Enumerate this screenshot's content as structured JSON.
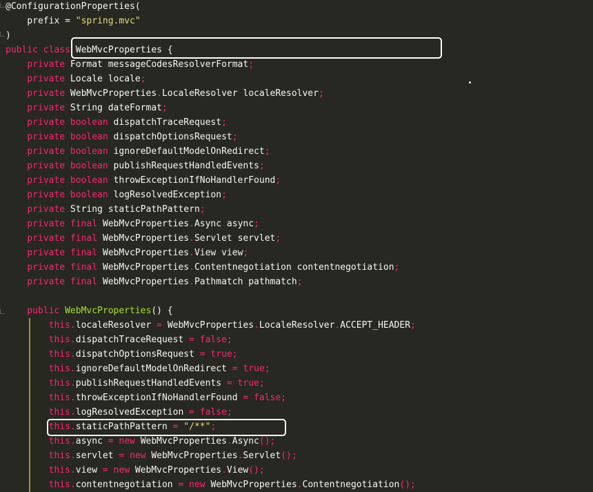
{
  "colors": {
    "background": "#272822",
    "keyword": "#F92672",
    "type": "#A6E22E",
    "string": "#E6DB74",
    "text": "#F8F8F2",
    "highlight_box": "#FFFFFF",
    "block_guide": "#B8A830"
  },
  "code": {
    "lines": [
      [
        {
          "t": "@ConfigurationProperties(",
          "c": "ann"
        }
      ],
      [
        {
          "t": "    prefix = ",
          "c": "ident"
        },
        {
          "t": "\"spring.mvc\"",
          "c": "str"
        }
      ],
      [
        {
          "t": ")",
          "c": "punct"
        }
      ],
      [
        {
          "t": "public class ",
          "c": "kw"
        },
        {
          "t": "WebMvcProperties",
          "c": "ident"
        },
        {
          "t": " {",
          "c": "punct"
        }
      ],
      [
        {
          "t": "    private ",
          "c": "kw"
        },
        {
          "t": "Format",
          "c": "ident"
        },
        {
          "t": " messageCodesResolverFormat",
          "c": "ident"
        },
        {
          "t": ";",
          "c": "kw"
        }
      ],
      [
        {
          "t": "    private ",
          "c": "kw"
        },
        {
          "t": "Locale",
          "c": "ident"
        },
        {
          "t": " locale",
          "c": "ident"
        },
        {
          "t": ";",
          "c": "kw"
        }
      ],
      [
        {
          "t": "    private ",
          "c": "kw"
        },
        {
          "t": "WebMvcProperties",
          "c": "ident"
        },
        {
          "t": ".",
          "c": "kw"
        },
        {
          "t": "LocaleResolver localeResolver",
          "c": "ident"
        },
        {
          "t": ";",
          "c": "kw"
        }
      ],
      [
        {
          "t": "    private ",
          "c": "kw"
        },
        {
          "t": "String",
          "c": "ident"
        },
        {
          "t": " dateFormat",
          "c": "ident"
        },
        {
          "t": ";",
          "c": "kw"
        }
      ],
      [
        {
          "t": "    private boolean ",
          "c": "kw"
        },
        {
          "t": "dispatchTraceRequest",
          "c": "ident"
        },
        {
          "t": ";",
          "c": "kw"
        }
      ],
      [
        {
          "t": "    private boolean ",
          "c": "kw"
        },
        {
          "t": "dispatchOptionsRequest",
          "c": "ident"
        },
        {
          "t": ";",
          "c": "kw"
        }
      ],
      [
        {
          "t": "    private boolean ",
          "c": "kw"
        },
        {
          "t": "ignoreDefaultModelOnRedirect",
          "c": "ident"
        },
        {
          "t": ";",
          "c": "kw"
        }
      ],
      [
        {
          "t": "    private boolean ",
          "c": "kw"
        },
        {
          "t": "publishRequestHandledEvents",
          "c": "ident"
        },
        {
          "t": ";",
          "c": "kw"
        }
      ],
      [
        {
          "t": "    private boolean ",
          "c": "kw"
        },
        {
          "t": "throwExceptionIfNoHandlerFound",
          "c": "ident"
        },
        {
          "t": ";",
          "c": "kw"
        }
      ],
      [
        {
          "t": "    private boolean ",
          "c": "kw"
        },
        {
          "t": "logResolvedException",
          "c": "ident"
        },
        {
          "t": ";",
          "c": "kw"
        }
      ],
      [
        {
          "t": "    private ",
          "c": "kw"
        },
        {
          "t": "String",
          "c": "ident"
        },
        {
          "t": " staticPathPattern",
          "c": "ident"
        },
        {
          "t": ";",
          "c": "kw"
        }
      ],
      [
        {
          "t": "    private final ",
          "c": "kw"
        },
        {
          "t": "WebMvcProperties",
          "c": "ident"
        },
        {
          "t": ".",
          "c": "kw"
        },
        {
          "t": "Async async",
          "c": "ident"
        },
        {
          "t": ";",
          "c": "kw"
        }
      ],
      [
        {
          "t": "    private final ",
          "c": "kw"
        },
        {
          "t": "WebMvcProperties",
          "c": "ident"
        },
        {
          "t": ".",
          "c": "kw"
        },
        {
          "t": "Servlet servlet",
          "c": "ident"
        },
        {
          "t": ";",
          "c": "kw"
        }
      ],
      [
        {
          "t": "    private final ",
          "c": "kw"
        },
        {
          "t": "WebMvcProperties",
          "c": "ident"
        },
        {
          "t": ".",
          "c": "kw"
        },
        {
          "t": "View view",
          "c": "ident"
        },
        {
          "t": ";",
          "c": "kw"
        }
      ],
      [
        {
          "t": "    private final ",
          "c": "kw"
        },
        {
          "t": "WebMvcProperties",
          "c": "ident"
        },
        {
          "t": ".",
          "c": "kw"
        },
        {
          "t": "Contentnegotiation contentnegotiation",
          "c": "ident"
        },
        {
          "t": ";",
          "c": "kw"
        }
      ],
      [
        {
          "t": "    private final ",
          "c": "kw"
        },
        {
          "t": "WebMvcProperties",
          "c": "ident"
        },
        {
          "t": ".",
          "c": "kw"
        },
        {
          "t": "Pathmatch pathmatch",
          "c": "ident"
        },
        {
          "t": ";",
          "c": "kw"
        }
      ],
      [],
      [
        {
          "t": "    public ",
          "c": "kw"
        },
        {
          "t": "WebMvcProperties",
          "c": "type"
        },
        {
          "t": "() {",
          "c": "punct"
        }
      ],
      [
        {
          "t": "        this.",
          "c": "kw"
        },
        {
          "t": "localeResolver",
          "c": "ident"
        },
        {
          "t": " = ",
          "c": "kw"
        },
        {
          "t": "WebMvcProperties",
          "c": "ident"
        },
        {
          "t": ".",
          "c": "kw"
        },
        {
          "t": "LocaleResolver",
          "c": "ident"
        },
        {
          "t": ".",
          "c": "kw"
        },
        {
          "t": "ACCEPT_HEADER",
          "c": "ident"
        },
        {
          "t": ";",
          "c": "kw"
        }
      ],
      [
        {
          "t": "        this.",
          "c": "kw"
        },
        {
          "t": "dispatchTraceRequest",
          "c": "ident"
        },
        {
          "t": " = false;",
          "c": "kw"
        }
      ],
      [
        {
          "t": "        this.",
          "c": "kw"
        },
        {
          "t": "dispatchOptionsRequest",
          "c": "ident"
        },
        {
          "t": " = true;",
          "c": "kw"
        }
      ],
      [
        {
          "t": "        this.",
          "c": "kw"
        },
        {
          "t": "ignoreDefaultModelOnRedirect",
          "c": "ident"
        },
        {
          "t": " = true;",
          "c": "kw"
        }
      ],
      [
        {
          "t": "        this.",
          "c": "kw"
        },
        {
          "t": "publishRequestHandledEvents",
          "c": "ident"
        },
        {
          "t": " = true;",
          "c": "kw"
        }
      ],
      [
        {
          "t": "        this.",
          "c": "kw"
        },
        {
          "t": "throwExceptionIfNoHandlerFound",
          "c": "ident"
        },
        {
          "t": " = false;",
          "c": "kw"
        }
      ],
      [
        {
          "t": "        this.",
          "c": "kw"
        },
        {
          "t": "logResolvedException",
          "c": "ident"
        },
        {
          "t": " = false;",
          "c": "kw"
        }
      ],
      [
        {
          "t": "        this.",
          "c": "kw"
        },
        {
          "t": "staticPathPattern",
          "c": "ident"
        },
        {
          "t": " = ",
          "c": "kw"
        },
        {
          "t": "\"/**\"",
          "c": "str"
        },
        {
          "t": ";",
          "c": "kw"
        }
      ],
      [
        {
          "t": "        this.",
          "c": "kw"
        },
        {
          "t": "async",
          "c": "ident"
        },
        {
          "t": " = new ",
          "c": "kw"
        },
        {
          "t": "WebMvcProperties",
          "c": "ident"
        },
        {
          "t": ".",
          "c": "kw"
        },
        {
          "t": "Async",
          "c": "ident"
        },
        {
          "t": "();",
          "c": "kw"
        }
      ],
      [
        {
          "t": "        this.",
          "c": "kw"
        },
        {
          "t": "servlet",
          "c": "ident"
        },
        {
          "t": " = new ",
          "c": "kw"
        },
        {
          "t": "WebMvcProperties",
          "c": "ident"
        },
        {
          "t": ".",
          "c": "kw"
        },
        {
          "t": "Servlet",
          "c": "ident"
        },
        {
          "t": "();",
          "c": "kw"
        }
      ],
      [
        {
          "t": "        this.",
          "c": "kw"
        },
        {
          "t": "view",
          "c": "ident"
        },
        {
          "t": " = new ",
          "c": "kw"
        },
        {
          "t": "WebMvcProperties",
          "c": "ident"
        },
        {
          "t": ".",
          "c": "kw"
        },
        {
          "t": "View",
          "c": "ident"
        },
        {
          "t": "();",
          "c": "kw"
        }
      ],
      [
        {
          "t": "        this.",
          "c": "kw"
        },
        {
          "t": "contentnegotiation",
          "c": "ident"
        },
        {
          "t": " = new ",
          "c": "kw"
        },
        {
          "t": "WebMvcProperties",
          "c": "ident"
        },
        {
          "t": ".",
          "c": "kw"
        },
        {
          "t": "Contentnegotiation",
          "c": "ident"
        },
        {
          "t": "();",
          "c": "kw"
        }
      ]
    ]
  }
}
